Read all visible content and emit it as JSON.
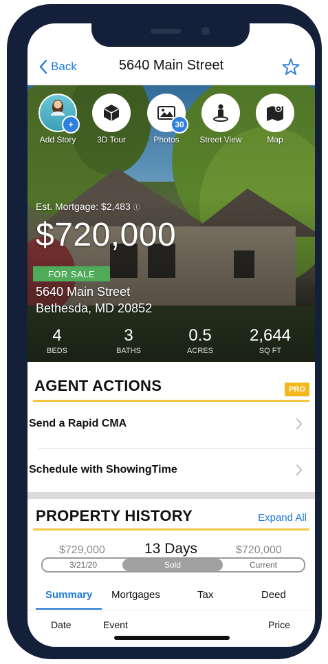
{
  "nav": {
    "back_label": "Back",
    "title": "5640 Main Street"
  },
  "quick_actions": [
    {
      "label": "Add Story",
      "icon": "avatar-plus-icon"
    },
    {
      "label": "3D Tour",
      "icon": "cube-icon"
    },
    {
      "label": "Photos",
      "icon": "photo-icon",
      "badge": "30"
    },
    {
      "label": "Street View",
      "icon": "street-view-icon"
    },
    {
      "label": "Map",
      "icon": "map-pin-icon"
    }
  ],
  "listing": {
    "mortgage": "Est. Mortgage: $2,483",
    "price": "$720,000",
    "status": "FOR SALE",
    "address_line1": "5640 Main Street",
    "address_line2": "Bethesda, MD 20852",
    "stats": [
      {
        "value": "4",
        "label": "BEDS"
      },
      {
        "value": "3",
        "label": "BATHS"
      },
      {
        "value": "0.5",
        "label": "ACRES"
      },
      {
        "value": "2,644",
        "label": "SQ FT"
      }
    ]
  },
  "agent_actions": {
    "title": "AGENT ACTIONS",
    "badge": "PRO",
    "items": [
      "Send a Rapid CMA",
      "Schedule with ShowingTime"
    ]
  },
  "property_history": {
    "title": "PROPERTY HISTORY",
    "expand_label": "Expand All",
    "old_price": "$729,000",
    "duration": "13 Days",
    "new_price": "$720,000",
    "timeline": {
      "start_date": "3/21/20",
      "middle": "Sold",
      "end": "Current"
    },
    "tabs": [
      "Summary",
      "Mortgages",
      "Tax",
      "Deed"
    ],
    "columns": [
      "Date",
      "Event",
      "Price"
    ]
  },
  "colors": {
    "accent_blue": "#1f7ad8",
    "sale_green": "#4faa5a",
    "pro_yellow": "#f5b81c",
    "frame_navy": "#142039"
  }
}
